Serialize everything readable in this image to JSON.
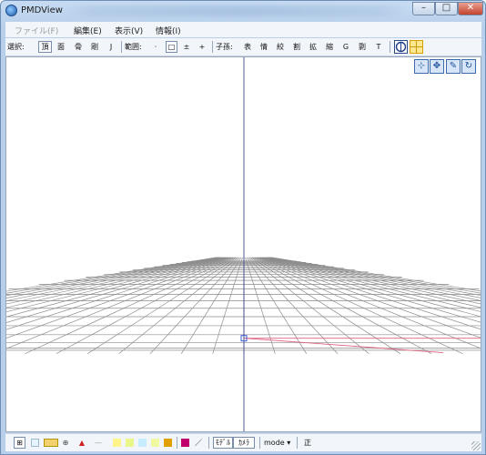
{
  "window": {
    "title": "PMDView"
  },
  "menu": [
    {
      "label": "ファイル(F)",
      "disabled": true
    },
    {
      "label": "編集(E)",
      "disabled": false
    },
    {
      "label": "表示(V)",
      "disabled": false
    },
    {
      "label": "情報(I)",
      "disabled": false
    }
  ],
  "toolbar": {
    "select_label": "選択:",
    "tools": [
      "頂",
      "面",
      "骨",
      "剛",
      "J"
    ],
    "range_label": "範囲:",
    "range_tools": [
      "·",
      "□",
      "±",
      "+"
    ],
    "child_label": "子孫:",
    "child_tools": [
      "表",
      "情",
      "絞",
      "割",
      "拡",
      "縮",
      "G",
      "剽",
      "T"
    ],
    "icons": [
      "circle-view-icon",
      "grid-toggle-icon"
    ]
  },
  "viewport": {
    "nav_icons": [
      "zoom-icon",
      "move-icon",
      "pen-icon",
      "rotate-icon"
    ],
    "grid_color": "#8c8c8c",
    "x_axis_color": "#e06080",
    "z_axis_color": "#e06080",
    "y_axis_color": "#3a4a8a"
  },
  "statusbar": {
    "mode_label": "mode",
    "mode_caret": "▾",
    "extra_label": "正",
    "buttons": [
      "ﾓﾃﾞﾙ",
      "ｶﾒﾗ"
    ],
    "swatch_colors": [
      "#d9ecff",
      "#b5e06a",
      "#f5d070",
      "#e8e8e8",
      "#cc2222",
      "#ffe35a",
      "#e9f58a",
      "#c6ecff",
      "#e0a000",
      "#c0006a"
    ]
  }
}
